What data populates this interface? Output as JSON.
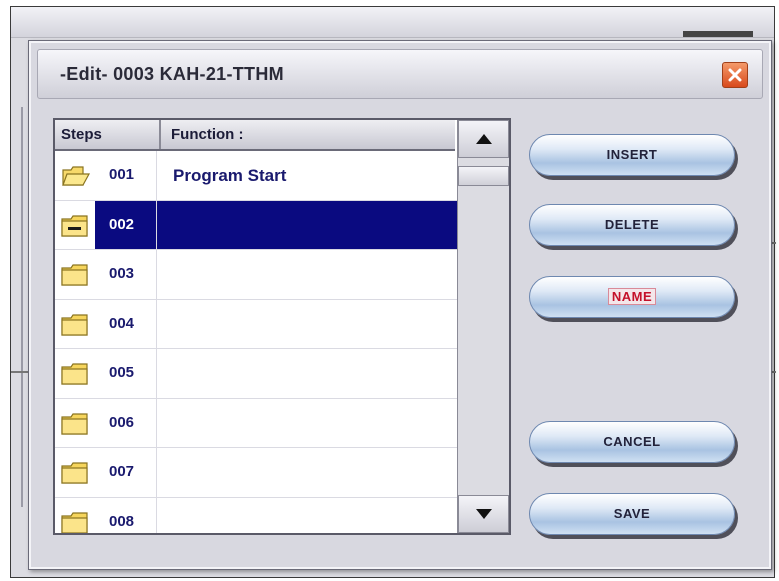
{
  "dialog": {
    "title": "-Edit- 0003 KAH-21-TTHM"
  },
  "list": {
    "headers": {
      "steps": "Steps",
      "function": "Function :"
    },
    "rows": [
      {
        "step": "001",
        "function": "Program Start",
        "selected": false,
        "icon": "folder-open-icon"
      },
      {
        "step": "002",
        "function": "",
        "selected": true,
        "icon": "folder-minus-icon"
      },
      {
        "step": "003",
        "function": "",
        "selected": false,
        "icon": "folder-icon"
      },
      {
        "step": "004",
        "function": "",
        "selected": false,
        "icon": "folder-icon"
      },
      {
        "step": "005",
        "function": "",
        "selected": false,
        "icon": "folder-icon"
      },
      {
        "step": "006",
        "function": "",
        "selected": false,
        "icon": "folder-icon"
      },
      {
        "step": "007",
        "function": "",
        "selected": false,
        "icon": "folder-icon"
      },
      {
        "step": "008",
        "function": "",
        "selected": false,
        "icon": "folder-icon"
      }
    ]
  },
  "buttons": {
    "insert": "INSERT",
    "delete": "DELETE",
    "name": "NAME",
    "cancel": "CANCEL",
    "save": "SAVE"
  },
  "colors": {
    "selection": "#0a0a80",
    "text_blue": "#1a1a6e",
    "close_button": "#e0602e",
    "name_label": "#c4102a"
  }
}
